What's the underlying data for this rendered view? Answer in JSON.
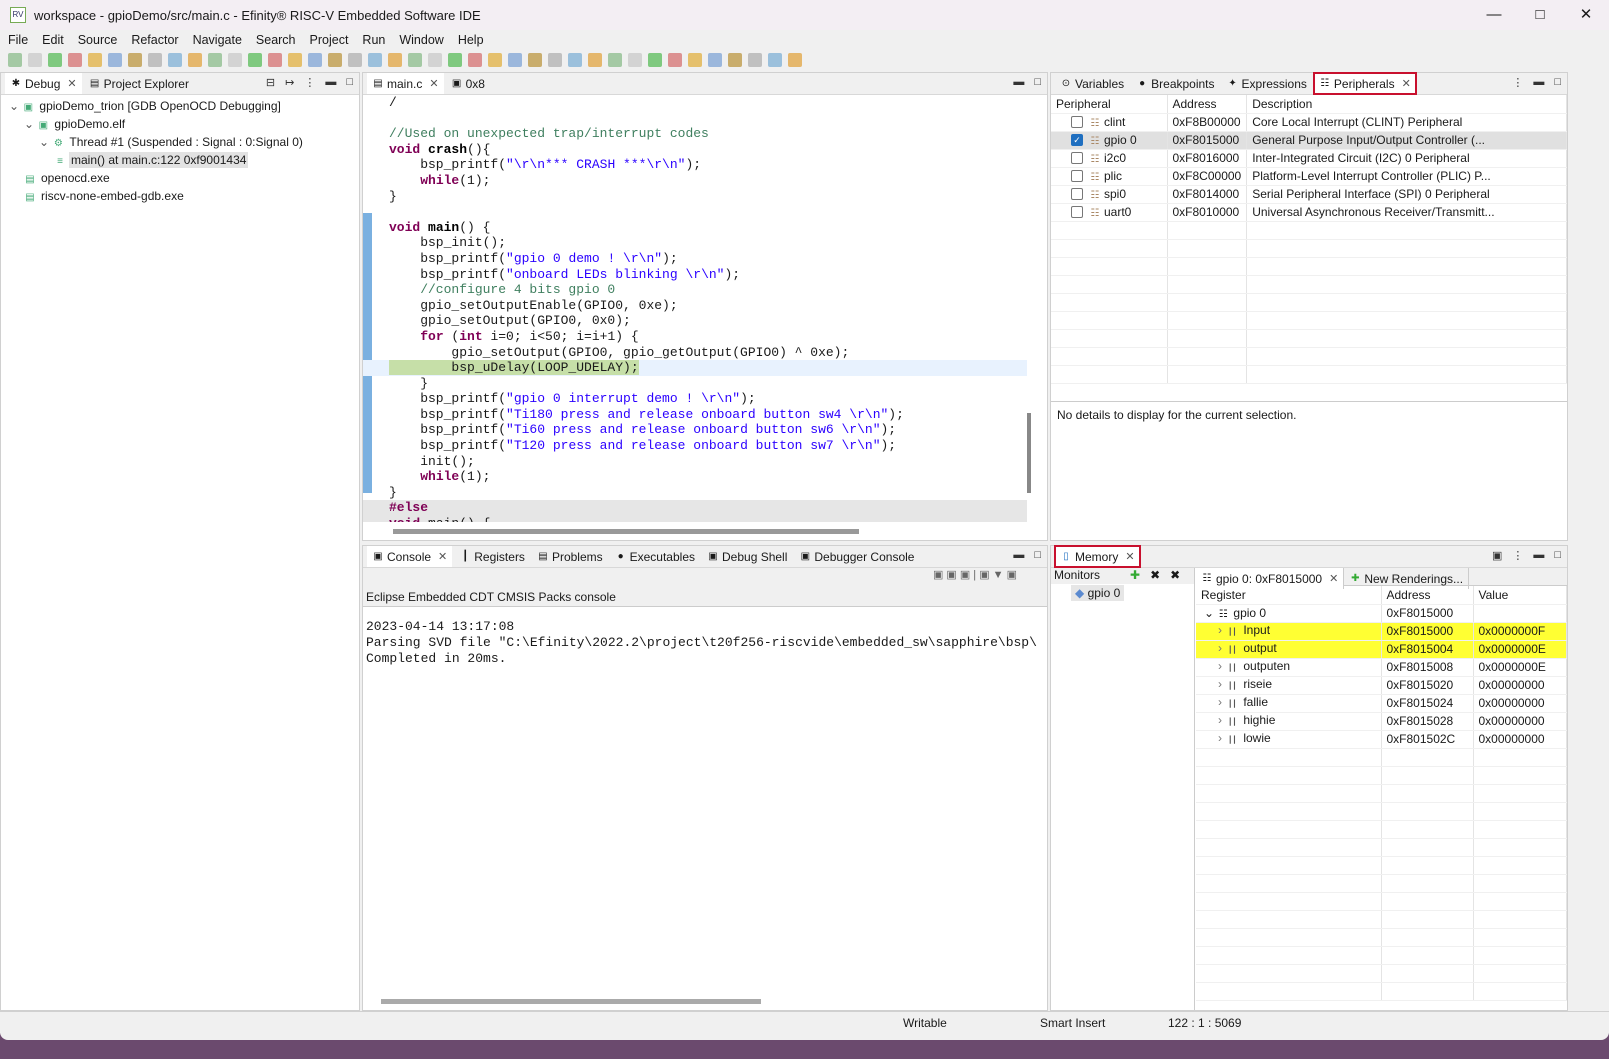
{
  "window": {
    "title": "workspace - gpioDemo/src/main.c - Efinity® RISC-V Embedded Software IDE",
    "app_icon": "RV"
  },
  "menu": [
    "File",
    "Edit",
    "Source",
    "Refactor",
    "Navigate",
    "Search",
    "Project",
    "Run",
    "Window",
    "Help"
  ],
  "debug_panel": {
    "tabs": [
      {
        "label": "Debug",
        "icon": "bug-icon"
      },
      {
        "label": "Project Explorer",
        "icon": "folder-icon"
      }
    ],
    "tree": [
      {
        "label": "gpioDemo_trion [GDB OpenOCD Debugging]",
        "level": 0
      },
      {
        "label": "gpioDemo.elf",
        "level": 1
      },
      {
        "label": "Thread #1 (Suspended : Signal : 0:Signal 0)",
        "level": 2
      },
      {
        "label": "main() at main.c:122 0xf9001434",
        "level": 3,
        "selected": true
      },
      {
        "label": "openocd.exe",
        "level": 1
      },
      {
        "label": "riscv-none-embed-gdb.exe",
        "level": 1
      }
    ]
  },
  "editor": {
    "tabs": [
      {
        "label": "main.c"
      },
      {
        "label": "0x8"
      }
    ],
    "lines": [
      [
        [
          "n",
          "/"
        ]
      ],
      [
        [
          "n",
          ""
        ]
      ],
      [
        [
          "c",
          "//Used on unexpected trap/interrupt codes"
        ]
      ],
      [
        [
          "k",
          "void "
        ],
        [
          "f",
          "crash"
        ],
        [
          "n",
          "(){"
        ]
      ],
      [
        [
          "n",
          "    bsp_printf("
        ],
        [
          "s",
          "\"\\r\\n*** CRASH ***\\r\\n\""
        ],
        [
          "n",
          ");"
        ]
      ],
      [
        [
          "n",
          "    "
        ],
        [
          "k",
          "while"
        ],
        [
          "n",
          "(1);"
        ]
      ],
      [
        [
          "n",
          "}"
        ]
      ],
      [
        [
          "n",
          ""
        ]
      ],
      [
        [
          "k",
          "void "
        ],
        [
          "f",
          "main"
        ],
        [
          "n",
          "() {"
        ]
      ],
      [
        [
          "n",
          "    bsp_init();"
        ]
      ],
      [
        [
          "n",
          "    bsp_printf("
        ],
        [
          "s",
          "\"gpio 0 demo ! \\r\\n\""
        ],
        [
          "n",
          ");"
        ]
      ],
      [
        [
          "n",
          "    bsp_printf("
        ],
        [
          "s",
          "\"onboard LEDs blinking \\r\\n\""
        ],
        [
          "n",
          ");"
        ]
      ],
      [
        [
          "c",
          "    //configure 4 bits gpio 0"
        ]
      ],
      [
        [
          "n",
          "    gpio_setOutputEnable(GPIO0, 0xe);"
        ]
      ],
      [
        [
          "n",
          "    gpio_setOutput(GPIO0, 0x0);"
        ]
      ],
      [
        [
          "n",
          "    "
        ],
        [
          "k",
          "for"
        ],
        [
          "n",
          " ("
        ],
        [
          "k",
          "int"
        ],
        [
          "n",
          " i=0; i<50; i=i+1) {"
        ]
      ],
      [
        [
          "n",
          "        gpio_setOutput(GPIO0, gpio_getOutput(GPIO0) ^ 0xe);"
        ]
      ],
      [
        [
          "g",
          "        bsp_uDelay(LOOP_UDELAY);"
        ]
      ],
      [
        [
          "n",
          "    }"
        ]
      ],
      [
        [
          "n",
          "    bsp_printf("
        ],
        [
          "s",
          "\"gpio 0 interrupt demo ! \\r\\n\""
        ],
        [
          "n",
          ");"
        ]
      ],
      [
        [
          "n",
          "    bsp_printf("
        ],
        [
          "s",
          "\"Ti180 press and release onboard button sw4 \\r\\n\""
        ],
        [
          "n",
          ");"
        ]
      ],
      [
        [
          "n",
          "    bsp_printf("
        ],
        [
          "s",
          "\"Ti60 press and release onboard button sw6 \\r\\n\""
        ],
        [
          "n",
          ");"
        ]
      ],
      [
        [
          "n",
          "    bsp_printf("
        ],
        [
          "s",
          "\"T120 press and release onboard button sw7 \\r\\n\""
        ],
        [
          "n",
          ");"
        ]
      ],
      [
        [
          "n",
          "    init();"
        ]
      ],
      [
        [
          "n",
          "    "
        ],
        [
          "k",
          "while"
        ],
        [
          "n",
          "(1);"
        ]
      ],
      [
        [
          "n",
          "}"
        ]
      ],
      [
        [
          "p",
          "#else"
        ]
      ],
      [
        [
          "k",
          "void "
        ],
        [
          "n",
          "main() {"
        ]
      ]
    ]
  },
  "right_top": {
    "tabs": [
      {
        "label": "Variables",
        "icon": "variables-icon"
      },
      {
        "label": "Breakpoints",
        "icon": "breakpoints-icon"
      },
      {
        "label": "Expressions",
        "icon": "expressions-icon"
      },
      {
        "label": "Peripherals",
        "icon": "peripherals-icon",
        "active": true
      }
    ],
    "columns": [
      "Peripheral",
      "Address",
      "Description"
    ],
    "rows": [
      {
        "name": "clint",
        "address": "0xF8B00000",
        "description": "Core Local Interrupt (CLINT) Peripheral",
        "checked": false
      },
      {
        "name": "gpio 0",
        "address": "0xF8015000",
        "description": "General Purpose Input/Output Controller (...",
        "checked": true
      },
      {
        "name": "i2c0",
        "address": "0xF8016000",
        "description": "Inter-Integrated Circuit (I2C) 0 Peripheral",
        "checked": false
      },
      {
        "name": "plic",
        "address": "0xF8C00000",
        "description": "Platform-Level Interrupt Controller (PLIC) P...",
        "checked": false
      },
      {
        "name": "spi0",
        "address": "0xF8014000",
        "description": "Serial Peripheral Interface (SPI) 0 Peripheral",
        "checked": false
      },
      {
        "name": "uart0",
        "address": "0xF8010000",
        "description": "Universal Asynchronous Receiver/Transmitt...",
        "checked": false
      }
    ],
    "details": "No details to display for the current selection."
  },
  "console": {
    "tabs": [
      {
        "label": "Console",
        "icon": "console-icon"
      },
      {
        "label": "Registers",
        "icon": "registers-icon"
      },
      {
        "label": "Problems",
        "icon": "problems-icon"
      },
      {
        "label": "Executables",
        "icon": "executables-icon"
      },
      {
        "label": "Debug Shell",
        "icon": "debug-shell-icon"
      },
      {
        "label": "Debugger Console",
        "icon": "debugger-console-icon"
      }
    ],
    "title": "Eclipse Embedded CDT CMSIS Packs console",
    "lines": [
      "2023-04-14 13:17:08",
      "Parsing SVD file \"C:\\Efinity\\2022.2\\project\\t20f256-riscvide\\embedded_sw\\sapphire\\bsp\\",
      "Completed in 20ms."
    ]
  },
  "memory": {
    "tab": "Memory",
    "monitors_label": "Monitors",
    "monitors": [
      "gpio 0"
    ],
    "rendering_tabs": [
      "gpio 0: 0xF8015000",
      "New Renderings..."
    ],
    "columns": [
      "Register",
      "Address",
      "Value"
    ],
    "group": {
      "name": "gpio 0",
      "address": "0xF8015000"
    },
    "registers": [
      {
        "name": "Input",
        "address": "0xF8015000",
        "value": "0x0000000F",
        "highlight": true
      },
      {
        "name": "output",
        "address": "0xF8015004",
        "value": "0x0000000E",
        "highlight": true
      },
      {
        "name": "outputen",
        "address": "0xF8015008",
        "value": "0x0000000E"
      },
      {
        "name": "riseie",
        "address": "0xF8015020",
        "value": "0x00000000"
      },
      {
        "name": "fallie",
        "address": "0xF8015024",
        "value": "0x00000000"
      },
      {
        "name": "highie",
        "address": "0xF8015028",
        "value": "0x00000000"
      },
      {
        "name": "lowie",
        "address": "0xF801502C",
        "value": "0x00000000"
      }
    ]
  },
  "status": {
    "mode": "Writable",
    "insert": "Smart Insert",
    "position": "122 : 1 : 5069"
  },
  "colors": {
    "highlight": "#ffff33",
    "callout": "#c8102e",
    "current_line": "#c6dfa8"
  }
}
